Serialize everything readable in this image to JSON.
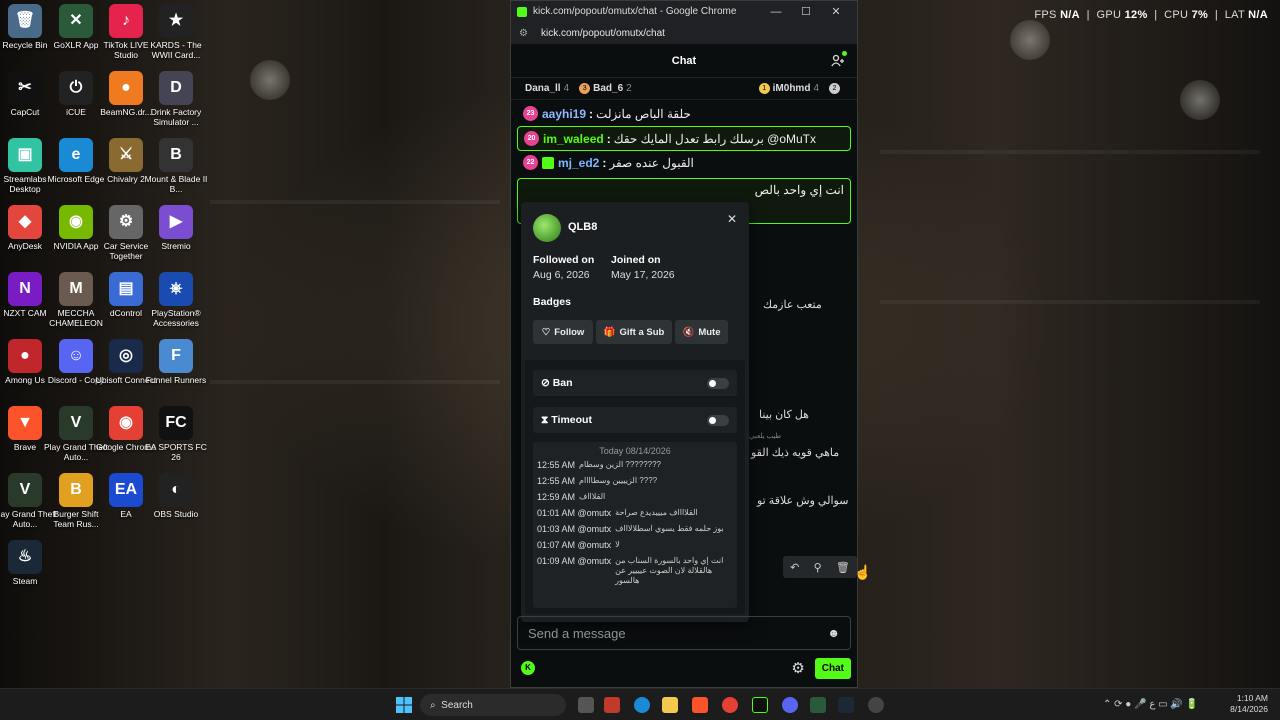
{
  "system": {
    "fps_label": "FPS",
    "fps_val": "N/A",
    "gpu_label": "GPU",
    "gpu_val": "12%",
    "cpu_label": "CPU",
    "cpu_val": "7%",
    "lat_label": "LAT",
    "lat_val": "N/A"
  },
  "desktop_icons": [
    {
      "label": "Recycle Bin",
      "color": "#4a6a8a",
      "glyph": "🗑"
    },
    {
      "label": "GoXLR App",
      "color": "#2a5a3a",
      "glyph": "✕"
    },
    {
      "label": "TikTok LIVE Studio",
      "color": "#e6234d",
      "glyph": "♪"
    },
    {
      "label": "KARDS - The WWII Card...",
      "color": "#222",
      "glyph": "★"
    },
    {
      "label": "CapCut",
      "color": "#111",
      "glyph": "✂"
    },
    {
      "label": "iCUE",
      "color": "#222",
      "glyph": "⏻"
    },
    {
      "label": "BeamNG.dr...",
      "color": "#f07a20",
      "glyph": "●"
    },
    {
      "label": "Drink Factory Simulator ...",
      "color": "#445",
      "glyph": "D"
    },
    {
      "label": "Streamlabs Desktop",
      "color": "#31c3a2",
      "glyph": "▣"
    },
    {
      "label": "Microsoft Edge",
      "color": "#1a8ad4",
      "glyph": "e"
    },
    {
      "label": "Chivalry 2",
      "color": "#8a6a30",
      "glyph": "⚔"
    },
    {
      "label": "Mount & Blade II B...",
      "color": "#333",
      "glyph": "B"
    },
    {
      "label": "AnyDesk",
      "color": "#e2463c",
      "glyph": "◆"
    },
    {
      "label": "NVIDIA App",
      "color": "#76b900",
      "glyph": "◉"
    },
    {
      "label": "Car Service Together",
      "color": "#666",
      "glyph": "⚙"
    },
    {
      "label": "Stremio",
      "color": "#7b4ed1",
      "glyph": "▶"
    },
    {
      "label": "NZXT CAM",
      "color": "#7a1cc4",
      "glyph": "N"
    },
    {
      "label": "MECCHA CHAMELEON",
      "color": "#6a5a50",
      "glyph": "M"
    },
    {
      "label": "dControl",
      "color": "#3a6ad4",
      "glyph": "▤"
    },
    {
      "label": "PlayStation® Accessories",
      "color": "#1a4bb0",
      "glyph": "⎈"
    },
    {
      "label": "Among Us",
      "color": "#c0272d",
      "glyph": "●"
    },
    {
      "label": "Discord - Copy",
      "color": "#5865f2",
      "glyph": "☺"
    },
    {
      "label": "Ubisoft Connect",
      "color": "#1a2a4a",
      "glyph": "◎"
    },
    {
      "label": "Funnel Runners",
      "color": "#4a8ad0",
      "glyph": "F"
    },
    {
      "label": "Brave",
      "color": "#fb542b",
      "glyph": "▼"
    },
    {
      "label": "Play Grand Theft Auto...",
      "color": "#2a3a2a",
      "glyph": "V"
    },
    {
      "label": "Google Chrome",
      "color": "#e44134",
      "glyph": "◉"
    },
    {
      "label": "EA SPORTS FC 26",
      "color": "#111",
      "glyph": "FC"
    },
    {
      "label": "Play Grand Theft Auto...",
      "color": "#2a3a2a",
      "glyph": "V"
    },
    {
      "label": "Burger Shift Team Rus...",
      "color": "#e2a020",
      "glyph": "B"
    },
    {
      "label": "EA",
      "color": "#1a4bd0",
      "glyph": "EA"
    },
    {
      "label": "OBS Studio",
      "color": "#222",
      "glyph": "◐"
    },
    {
      "label": "Steam",
      "color": "#1b2838",
      "glyph": "♨"
    }
  ],
  "window": {
    "title": "kick.com/popout/omutx/chat - Google Chrome",
    "url": "kick.com/popout/omutx/chat",
    "min": "—",
    "max": "☐",
    "close": "✕"
  },
  "chat": {
    "header": "Chat",
    "gifters": [
      {
        "name": "Dana_ll",
        "count": "4",
        "badge": ""
      },
      {
        "name": "Bad_6",
        "count": "2",
        "badge": "3"
      },
      {
        "name": "iM0hmd",
        "count": "4",
        "badge": "1"
      }
    ],
    "gifter_more": "2",
    "messages": [
      {
        "sub": "23",
        "user": "aayhi19",
        "color": "#8fb8ff",
        "text": "حلقة الباص مانزلت"
      },
      {
        "sub": "20",
        "user": "im_waleed",
        "color": "#53fc18",
        "text": "برسلك رابط تعدل المايك حقك @oMuTx"
      },
      {
        "sub": "22",
        "user": "mj_ed2",
        "color": "#7fb4ff",
        "text": "القبول عنده صفر"
      }
    ],
    "partial_msg": "انت إي واحد بالص",
    "bg_lines": [
      "متعب عازمك",
      "هل كان بينا",
      "طيب يلعبي",
      "ماهي قويه ذيك القو",
      "سوالي وش علاقة تو"
    ],
    "input_placeholder": "Send a message",
    "send_label": "Chat",
    "kick_badge": "K"
  },
  "card": {
    "username": "QLB8",
    "followed_label": "Followed on",
    "followed_val": "Aug 6, 2026",
    "joined_label": "Joined on",
    "joined_val": "May 17, 2026",
    "badges_label": "Badges",
    "follow_btn": "Follow",
    "gift_btn": "Gift a Sub",
    "mute_btn": "Mute",
    "ban_label": "Ban",
    "timeout_label": "Timeout",
    "history_date": "Today 08/14/2026",
    "history": [
      {
        "time": "12:55 AM",
        "msg": "الزين وسطام ????????"
      },
      {
        "time": "12:55 AM",
        "msg": "الزيييين وسطاااام ????"
      },
      {
        "time": "12:59 AM",
        "msg": "القلاااف"
      },
      {
        "time": "01:01 AM @omutx",
        "msg": "القلااااف ميييديدع صراحة"
      },
      {
        "time": "01:03 AM @omutx",
        "msg": "بوز حلمه فقط يسوي اسطلالاااف"
      },
      {
        "time": "01:07 AM @omutx",
        "msg": "لا"
      },
      {
        "time": "01:09 AM @omutx",
        "msg": "انت إي واحد بالسورة السناب من هالقلالة لان الصوت عيييير عن هالسور"
      }
    ]
  },
  "taskbar": {
    "search_label": "Search",
    "time": "1:10 AM",
    "date": "8/14/2026",
    "lang": "ع"
  }
}
